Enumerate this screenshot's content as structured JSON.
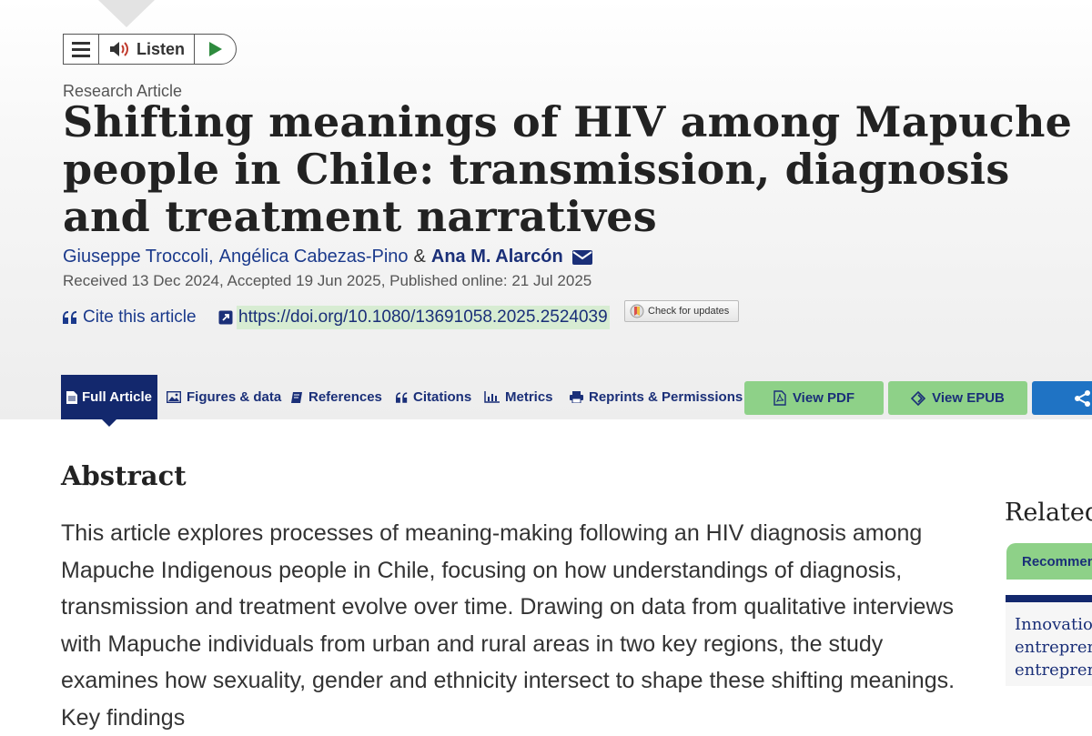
{
  "listen_widget": {
    "label": "Listen"
  },
  "article": {
    "type": "Research Article",
    "title": "Shifting meanings of HIV among Mapuche people in Chile: transmission, diagnosis and treatment narratives",
    "authors": [
      "Giuseppe Troccoli",
      "Angélica Cabezas-Pino",
      "Ana M. Alarcón"
    ],
    "author_separator": ",",
    "author_conjunction": "&",
    "dates": "Received 13 Dec 2024, Accepted 19 Jun 2025, Published online: 21 Jul 2025",
    "cite_label": "Cite this article",
    "doi": "https://doi.org/10.1080/13691058.2025.2524039",
    "check_updates_label": "Check for updates"
  },
  "tabs": [
    {
      "label": "Full Article",
      "icon": "document-icon",
      "active": true
    },
    {
      "label": "Figures & data",
      "icon": "image-icon"
    },
    {
      "label": "References",
      "icon": "book-icon"
    },
    {
      "label": "Citations",
      "icon": "quote-icon"
    },
    {
      "label": "Metrics",
      "icon": "bar-chart-icon"
    },
    {
      "label": "Reprints & Permissions",
      "icon": "printer-icon"
    }
  ],
  "actions": {
    "view_pdf": "View PDF",
    "view_epub": "View EPUB"
  },
  "abstract": {
    "heading": "Abstract",
    "text": "This article explores processes of meaning-making following an HIV diagnosis among Mapuche Indigenous people in Chile, focusing on how understandings of diagnosis, transmission and treatment evolve over time. Drawing on data from qualitative interviews with Mapuche individuals from urban and rural areas in two key regions, the study examines how sexuality, gender and ethnicity intersect to shape these shifting meanings. Key findings"
  },
  "sidebar": {
    "heading": "Related",
    "tab_label": "Recommen",
    "card_lines": [
      "Innovation",
      "entreprene",
      "entreprene"
    ]
  },
  "colors": {
    "navy": "#13286d",
    "link": "#1b3a8c",
    "green": "#8ed188",
    "share_blue": "#1f73c4"
  }
}
